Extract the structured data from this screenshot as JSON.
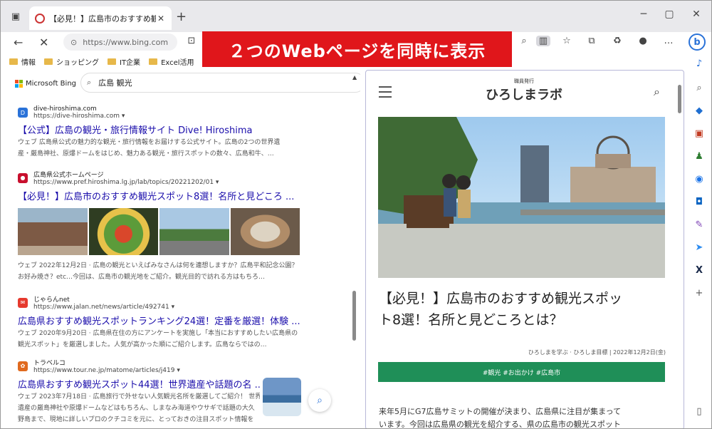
{
  "window": {
    "tab_title": "【必見！】広島市のおすすめ観光スポ",
    "tab_close": "✕",
    "new_tab": "+",
    "minimize": "─",
    "maximize": "▢",
    "close": "✕"
  },
  "addressbar": {
    "back": "←",
    "stop": "✕",
    "url": "https://www.bing.com",
    "lock": "🔒"
  },
  "favorites": [
    {
      "label": "情報"
    },
    {
      "label": "ショッピング"
    },
    {
      "label": "IT企業"
    },
    {
      "label": "Excel活用"
    }
  ],
  "banner": {
    "text": "２つのWebページを同時に表示"
  },
  "left": {
    "brand": "Microsoft Bing",
    "search_value": "広島 観光",
    "results": [
      {
        "site": "dive-hiroshima.com",
        "url": "https://dive-hiroshima.com ▾",
        "title": "【公式】広島の観光・旅行情報サイト Dive! Hiroshima",
        "snippet": "ウェブ 広島県公式の魅力的な観光・旅行情報をお届けする公式サイト。広島の2つの世界遺",
        "snippet2": "産・厳島神社、原爆ドームをはじめ、魅力ある観光・旅行スポットの数々、広島和牛、…"
      },
      {
        "site": "広島県公式ホームページ",
        "url": "https://www.pref.hiroshima.lg.jp/lab/topics/20221202/01 ▾",
        "title": "【必見！】広島市のおすすめ観光スポット8選！名所と見どころ ...",
        "snippet": "ウェブ 2022年12月2日 · 広島の観光といえばみなさんは何を連想しますか？広島平和記念公園？",
        "snippet2": "お好み焼き？etc…今回は、広島市の観光地をご紹介。観光目的で訪れる方はもちろ…"
      },
      {
        "site": "じゃらんnet",
        "url": "https://www.jalan.net/news/article/492741 ▾",
        "title": "広島県おすすめ観光スポットランキング24選！定番を厳選！体験 ...",
        "snippet": "ウェブ 2020年9月20日 · 広島県在住の方にアンケートを実施し「本当におすすめしたい広島県の",
        "snippet2": "観光スポット」を厳選しました。人気が高かった順にご紹介します。広島ならではの…"
      },
      {
        "site": "トラベルコ",
        "url": "https://www.tour.ne.jp/matome/articles/j419 ▾",
        "title": "広島県おすすめ観光スポット44選！世界遺産や話題の名 ...",
        "snippet": "ウェブ 2023年7月18日 · 広島旅行で外せない人気観光名所を厳選してご紹介！ 世界",
        "snippet2": "遺産の厳島神社や原爆ドームなどはもちろん、しまなみ海道やウサギで話題の大久",
        "snippet3": "野島まで、現地に詳しいプロのクチコミを元に、とっておきの注目スポット情報を"
      }
    ]
  },
  "right": {
    "logo_small": "職員発行",
    "logo": "ひろしまラボ",
    "article_title_1": "【必見！】広島市のおすすめ観光スポッ",
    "article_title_2": "ト8選！名所と見どころとは？",
    "meta": "ひろしまを学ぶ · ひろしま目標 | 2022年12月2日(金)",
    "tags": "#観光  #お出かけ  #広島市",
    "body_1": "来年5月にG7広島サミットの開催が決まり、広島県に注目が集まって",
    "body_2": "います。今回は広島県の観光を紹介する、県の広島市の観光スポット"
  },
  "colors": {
    "banner": "#e0161b",
    "link": "#1a0dab",
    "tag_bg": "#1f8f58",
    "accent": "#2a72d8"
  }
}
